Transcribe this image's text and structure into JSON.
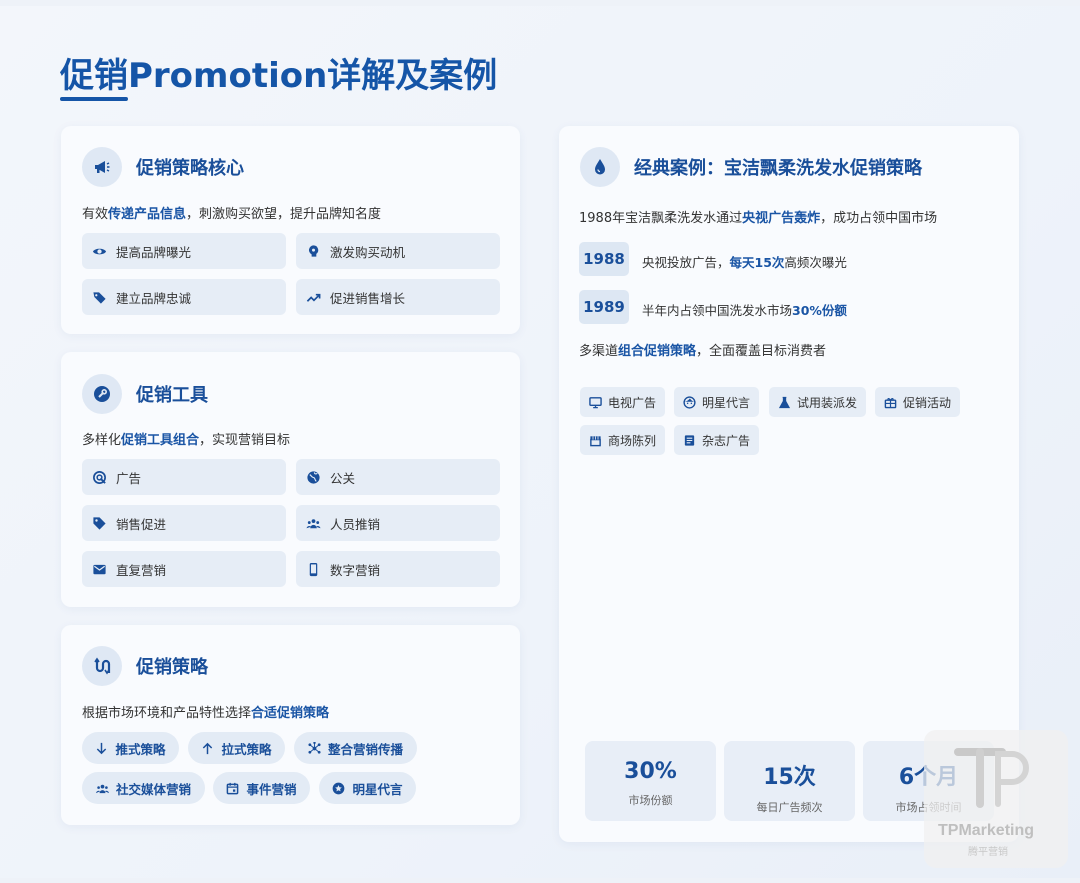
{
  "title": "促销Promotion详解及案例",
  "core": {
    "title": "促销策略核心",
    "desc_pre": "有效",
    "desc_hl": "传递产品信息",
    "desc_post": "，刺激购买欲望，提升品牌知名度",
    "items": [
      {
        "label": "提高品牌曝光",
        "icon": "eye-icon"
      },
      {
        "label": "激发购买动机",
        "icon": "brain-icon"
      },
      {
        "label": "建立品牌忠诚",
        "icon": "tags-icon"
      },
      {
        "label": "促进销售增长",
        "icon": "trend-up-icon"
      }
    ]
  },
  "tools": {
    "title": "促销工具",
    "desc_pre": "多样化",
    "desc_hl": "促销工具组合",
    "desc_post": "，实现营销目标",
    "items": [
      {
        "label": "广告",
        "icon": "ad-icon"
      },
      {
        "label": "公关",
        "icon": "globe-icon"
      },
      {
        "label": "销售促进",
        "icon": "tag-icon"
      },
      {
        "label": "人员推销",
        "icon": "people-icon"
      },
      {
        "label": "直复营销",
        "icon": "mail-icon"
      },
      {
        "label": "数字营销",
        "icon": "phone-icon"
      }
    ]
  },
  "strategy": {
    "title": "促销策略",
    "desc_pre": "根据市场环境和产品特性选择",
    "desc_hl": "合适促销策略",
    "pills": [
      {
        "label": "推式策略",
        "icon": "arrow-down-icon"
      },
      {
        "label": "拉式策略",
        "icon": "arrow-up-icon"
      },
      {
        "label": "整合营销传播",
        "icon": "network-icon"
      },
      {
        "label": "社交媒体营销",
        "icon": "users-icon"
      },
      {
        "label": "事件营销",
        "icon": "calendar-icon"
      },
      {
        "label": "明星代言",
        "icon": "star-icon"
      }
    ]
  },
  "case": {
    "title": "经典案例：宝洁飘柔洗发水促销策略",
    "intro_pre": "1988年宝洁飘柔洗发水通过",
    "intro_hl": "央视广告轰炸",
    "intro_post": "，成功占领中国市场",
    "timeline": [
      {
        "year": "1988",
        "pre": "央视投放广告，",
        "hl": "每天15次",
        "post": "高频次曝光"
      },
      {
        "year": "1989",
        "pre": "半年内占领中国洗发水市场",
        "hl": "30%份额",
        "post": ""
      }
    ],
    "channel_pre": "多渠道",
    "channel_hl": "组合促销策略",
    "channel_post": "，全面覆盖目标消费者",
    "tags": [
      {
        "label": "电视广告",
        "icon": "tv-icon"
      },
      {
        "label": "明星代言",
        "icon": "face-icon"
      },
      {
        "label": "试用装派发",
        "icon": "flask-icon"
      },
      {
        "label": "促销活动",
        "icon": "gift-icon"
      },
      {
        "label": "商场陈列",
        "icon": "store-icon"
      },
      {
        "label": "杂志广告",
        "icon": "magazine-icon"
      }
    ],
    "stats": [
      {
        "value": "30%",
        "label": "市场份额"
      },
      {
        "value": "15次",
        "label": "每日广告频次"
      },
      {
        "value": "6个月",
        "label": "市场占领时间"
      }
    ]
  },
  "watermark": {
    "name": "TPMarketing",
    "sub": "腾平营销"
  },
  "colors": {
    "accent": "#1555a7",
    "tile": "#e6edf6",
    "card": "#f9fbfe"
  }
}
